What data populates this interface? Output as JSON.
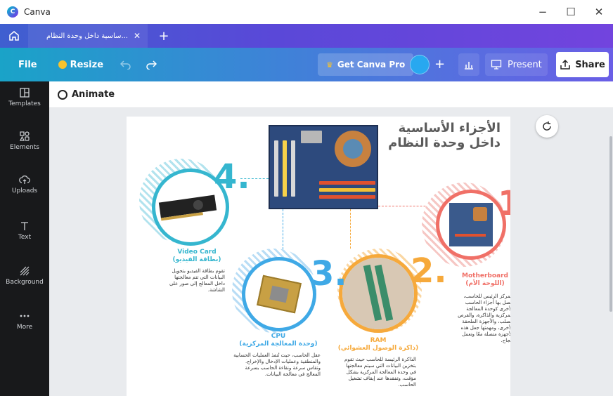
{
  "window": {
    "app_name": "Canva",
    "controls": {
      "minimize": "−",
      "maximize": "☐",
      "close": "✕"
    }
  },
  "tabs": [
    {
      "label": "...ساسية داخل وحدة النظام",
      "close": "✕"
    }
  ],
  "tab_add": "+",
  "toolbar": {
    "file": "File",
    "resize": "Resize",
    "get_pro": "Get Canva Pro",
    "present": "Present",
    "share": "Share",
    "plus": "+"
  },
  "sidebar": {
    "items": [
      {
        "label": "Templates",
        "icon": "templates-icon"
      },
      {
        "label": "Elements",
        "icon": "elements-icon"
      },
      {
        "label": "Uploads",
        "icon": "uploads-icon"
      },
      {
        "label": "Text",
        "icon": "text-icon"
      },
      {
        "label": "Background",
        "icon": "background-icon"
      },
      {
        "label": "More",
        "icon": "more-icon"
      }
    ]
  },
  "editor": {
    "animate": "Animate"
  },
  "design": {
    "title_line1": "الأجزاء الأساسية",
    "title_line2": "داخل وحدة النظام",
    "parts": [
      {
        "number": "1.",
        "color": "#f07067",
        "title_en": "Motherboard",
        "title_ar": "(اللوحة الأم)",
        "text": "المركز الرئيس للحاسب، تتصل بها أجزاء الحاسب الأخرى كوحدة المعالجة المركزية والذاكرة، والقرص الصلب، والأجهزة الملحقة الأخرى، ومهمتها جعل هذه الأجهزة متصلة معًا وتعمل بنجاح."
      },
      {
        "number": "2.",
        "color": "#f6a93b",
        "title_en": "RAM",
        "title_ar": "(ذاكرة الوصول العشوائي)",
        "text": "الذاكرة الرئيسة للحاسب حيث تقوم بتخزين البيانات التي سيتم معالجتها في وحدة المعالجة المركزية بشكل مؤقت، وتفقدها عند إيقاف تشغيل الحاسب."
      },
      {
        "number": "3.",
        "color": "#3fa9e6",
        "title_en": "CPU",
        "title_ar": "(وحدة المعالجة المركزية)",
        "text": "عقل الحاسب، حيث تُنفذ العمليات الحسابية والمنطقية وعمليات الإدخال والإخراج. وتقاس سرعة ونقاءة الحاسب بسرعة المعالج في معالجة البيانات."
      },
      {
        "number": "4.",
        "color": "#35b6cf",
        "title_en": "Video Card",
        "title_ar": "(بطاقة الفيديو)",
        "text": "تقوم بطاقة الفيديو بتحويل البيانات التي تتم معالجتها داخل المعالج إلى صور على الشاشة."
      }
    ]
  }
}
